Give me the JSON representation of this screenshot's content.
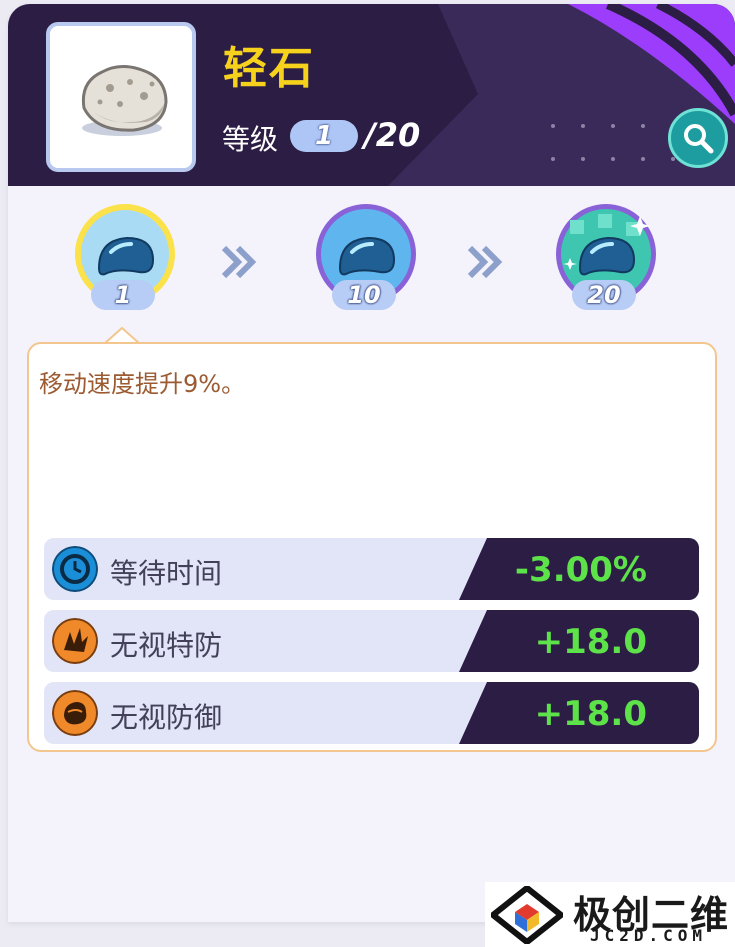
{
  "item": {
    "name": "轻石",
    "image_icon": "pumice-stone-icon",
    "level_label": "等级",
    "current_level": "1",
    "max_level": "/20"
  },
  "search": {
    "icon": "magnifier-icon"
  },
  "tiers": [
    {
      "level": "1",
      "state": "selected"
    },
    {
      "level": "10",
      "state": "normal"
    },
    {
      "level": "20",
      "state": "normal"
    }
  ],
  "description": "移动速度提升9%。",
  "stats": [
    {
      "label": "等待时间",
      "value": "-3.00%",
      "icon": "clock-icon",
      "icon_color": "#1a8fd8"
    },
    {
      "label": "无视特防",
      "value": "+18.0",
      "icon": "burst-icon",
      "icon_color": "#f0892a"
    },
    {
      "label": "无视防御",
      "value": "+18.0",
      "icon": "fist-icon",
      "icon_color": "#f0892a"
    }
  ],
  "watermark": {
    "title": "极创二维",
    "sub": "JC2D.COM"
  },
  "colors": {
    "header_bg": "#2b1d44",
    "name_yellow": "#f6d21d",
    "value_green": "#5ee24a",
    "accent_purple": "#9b3dfb",
    "desc_border": "#f2c68e"
  }
}
